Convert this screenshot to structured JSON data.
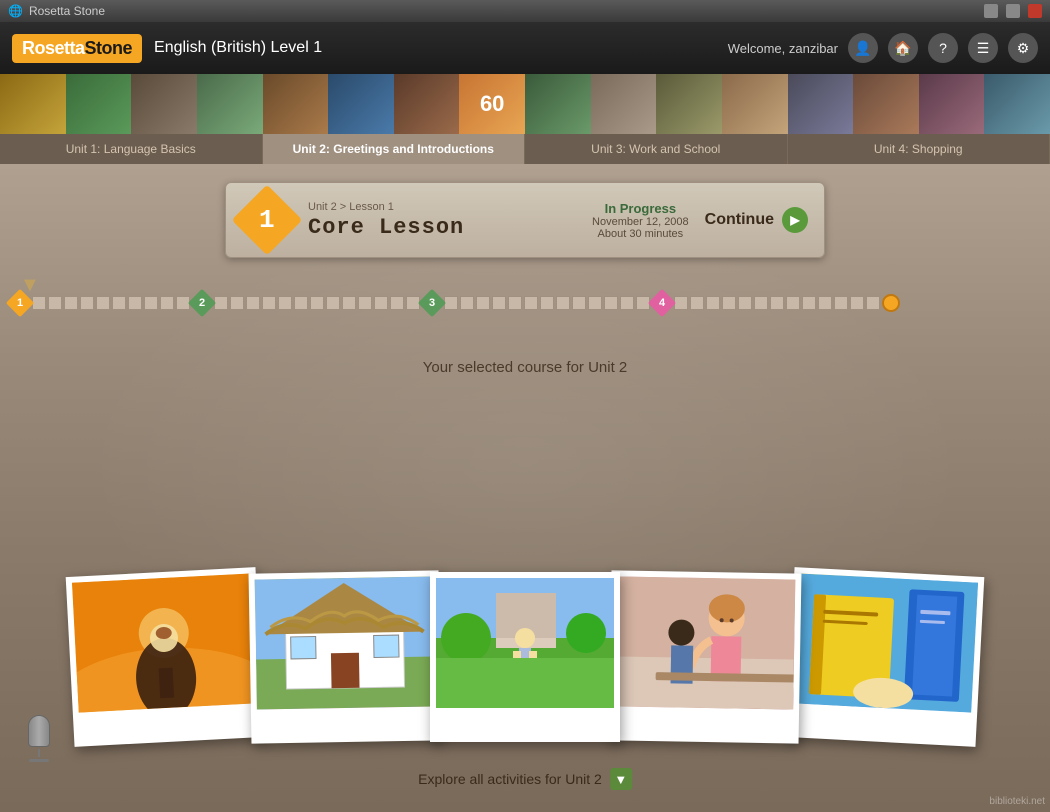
{
  "app": {
    "title": "Rosetta Stone",
    "window_title": "Rosetta Stone"
  },
  "header": {
    "logo_text": "Rosetta",
    "logo_bold": "Stone",
    "course_title": "English (British) Level 1",
    "welcome_text": "Welcome, zanzibar"
  },
  "units": [
    {
      "id": "unit1",
      "label": "Unit 1: Language Basics"
    },
    {
      "id": "unit2",
      "label": "Unit 2: Greetings and Introductions"
    },
    {
      "id": "unit3",
      "label": "Unit 3: Work and School"
    },
    {
      "id": "unit4",
      "label": "Unit 4: Shopping"
    }
  ],
  "lesson_card": {
    "number": "1",
    "path": "Unit 2 > Lesson 1",
    "name": "Core Lesson",
    "status": "In Progress",
    "date": "November 12, 2008",
    "duration": "About 30 minutes",
    "continue_label": "Continue"
  },
  "progress": {
    "arrow": "▼"
  },
  "main": {
    "selected_course_text": "Your selected course for Unit 2"
  },
  "photos": [
    {
      "id": "photo1",
      "desc": "child with flashlight in tent"
    },
    {
      "id": "photo2",
      "desc": "thatched roof cottage"
    },
    {
      "id": "photo3",
      "desc": "child in garden"
    },
    {
      "id": "photo4",
      "desc": "woman teacher with student"
    },
    {
      "id": "photo5",
      "desc": "books and reading"
    }
  ],
  "explore_button": {
    "label": "Explore all activities for Unit 2"
  },
  "watermark": "biblioteki.net"
}
